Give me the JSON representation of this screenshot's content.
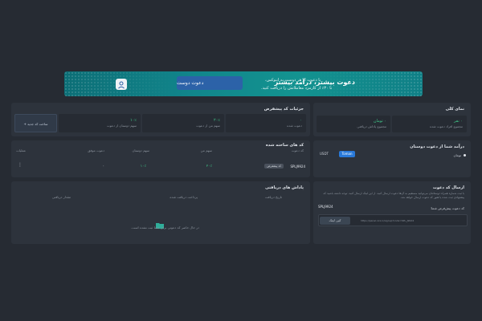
{
  "banner": {
    "title": "دعوت بیشتر، درآمد بیشتر",
    "line1": "با دعوت از هر دوست به اینوکس،",
    "line2": "تا ۳۰٪ از کارمزد معاملاتش را دریافت کنید.",
    "button": "دعوت دوست"
  },
  "overview": {
    "title": "نمای کلی",
    "stats": [
      {
        "value": "۰ نفر",
        "label": "مجموع افراد دعوت شده"
      },
      {
        "value": "۰ تومان",
        "label": "مجموع پاداش دریافتی"
      }
    ]
  },
  "income": {
    "title": "درآمد شما از دعوت دوستان",
    "option_label": "تومان",
    "toggle": [
      "USDT",
      "Toman"
    ]
  },
  "send": {
    "title": "ارسال کد دعوت",
    "text": "با ثبت شماره همراه دوستانتان می‌توانید مستقیم به آن‌ها دعوت ارسال کنید. از این لینک ارسال کنید. توجه داشته باشید که پیشنهادی ثبت شده یا هنوز کد دعوت ارسال خواهد شد.",
    "default_code_label": "کد دعوت پیش‌فرض شما:",
    "code": "SPLJ9924",
    "link": "https://panel.xxx.ir/signup?code=SPL_J9924",
    "copy_label": "کپی لینک"
  },
  "details": {
    "title": "جزئیات کد پیشفرض",
    "stats": [
      {
        "value": "۰",
        "label": "دعوت شده"
      },
      {
        "value": "۲۰٪",
        "label": "سهم من از دعوت"
      },
      {
        "value": "۱۰٪",
        "label": "سهم دوستان از دعوت"
      }
    ],
    "add_button": "+ ساخت کد جدید"
  },
  "codes": {
    "title": "کد های ساخته شده",
    "headers": [
      "کد دعوت",
      "سهم من",
      "سهم دوستان",
      "دعوت موفق",
      "عملیات"
    ],
    "rows": [
      {
        "code": "SPLJ9924",
        "badge": "کد پیشفرض",
        "mine": "۲۰٪",
        "friends": "۱۰٪",
        "invites": "۰"
      }
    ]
  },
  "rewards": {
    "title": "پاداش های دریافتی",
    "headers": [
      "تاریخ دریافت",
      "پرداخت دریافت شده",
      "مقدار دریافتی"
    ],
    "empty_text": "در حال حاضر کد دعوتی برای شما ثبت نشده است."
  },
  "colors": {
    "accent": "#2c62a8",
    "toggle_active": "#2979d8",
    "success": "#41c98a"
  }
}
